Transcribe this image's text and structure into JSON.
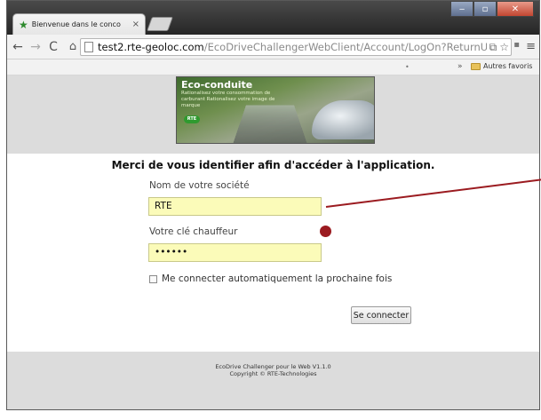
{
  "browser": {
    "tab_title": "Bienvenue dans le conco",
    "tab_close": "×",
    "address_host": "test2.rte-geoloc.com",
    "address_path": "/EcoDriveChallengerWebClient/Account/LogOn?ReturnUrl",
    "bookmark_folder": "Autres favoris",
    "bookmark_chevron": "»"
  },
  "banner": {
    "title": "Eco-conduite",
    "subtitle": "Rationalisez votre consommation de carburant Rationalisez votre image de marque",
    "badge": "RTE"
  },
  "form": {
    "heading": "Merci de vous identifier afin d'accéder à l'application.",
    "company_label": "Nom de votre société",
    "company_value": "RTE",
    "key_label": "Votre clé chauffeur",
    "key_value": "••••••",
    "remember_label": "Me connecter automatiquement la prochaine fois",
    "submit_label": "Se connecter"
  },
  "footer": {
    "line1": "EcoDrive Challenger pour le Web V1.1.0",
    "line2": "Copyright © RTE-Technologies"
  },
  "colors": {
    "input_bg": "#fbfbb9",
    "annotation": "#9b1b20"
  }
}
